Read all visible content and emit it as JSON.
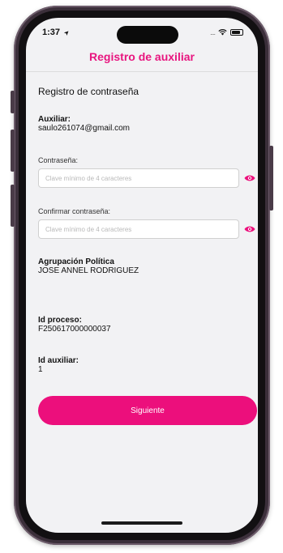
{
  "status_bar": {
    "time": "1:37",
    "signal": "....",
    "location_arrow": "➤"
  },
  "header": {
    "title": "Registro de auxiliar"
  },
  "form": {
    "section_title": "Registro de contraseña",
    "auxiliar_label": "Auxiliar:",
    "auxiliar_value": "saulo261074@gmail.com",
    "password_label": "Contraseña:",
    "password_placeholder": "Clave mínimo de 4 caracteres",
    "password_value": "",
    "confirm_label": "Confirmar contraseña:",
    "confirm_placeholder": "Clave mínimo de 4 caracteres",
    "confirm_value": "",
    "party_label": "Agrupación Política",
    "party_value": "JOSE ANNEL RODRIGUEZ",
    "process_label": "Id proceso:",
    "process_value": "F250617000000037",
    "aux_id_label": "Id auxiliar:",
    "aux_id_value": "1",
    "submit_label": "Siguiente"
  },
  "icons": {
    "password_toggle": "eye-icon",
    "confirm_toggle": "eye-icon"
  },
  "colors": {
    "accent": "#ec0f7c",
    "title": "#e8157f",
    "frame": "#3b2f3a"
  }
}
